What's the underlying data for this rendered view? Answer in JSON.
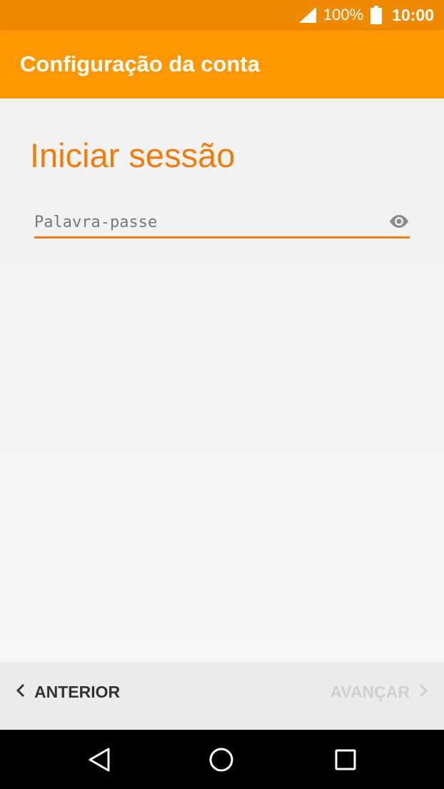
{
  "status_bar": {
    "battery_percent": "100%",
    "clock": "10:00",
    "icons": [
      "signal-icon",
      "battery-icon"
    ]
  },
  "app_bar": {
    "title": "Configuração da conta"
  },
  "main": {
    "heading": "Iniciar sessão",
    "password_field": {
      "placeholder": "Palavra-passe",
      "value": ""
    }
  },
  "bottom_bar": {
    "back_label": "ANTERIOR",
    "next_label": "AVANÇAR",
    "next_enabled": false
  },
  "nav_bar": {
    "icons": [
      "back-triangle-icon",
      "home-circle-icon",
      "recents-square-icon"
    ]
  },
  "colors": {
    "status_bar": "#ee8a00",
    "app_bar": "#ff9800",
    "accent": "#ef7d0b",
    "disabled_text": "#cfcfcf"
  }
}
